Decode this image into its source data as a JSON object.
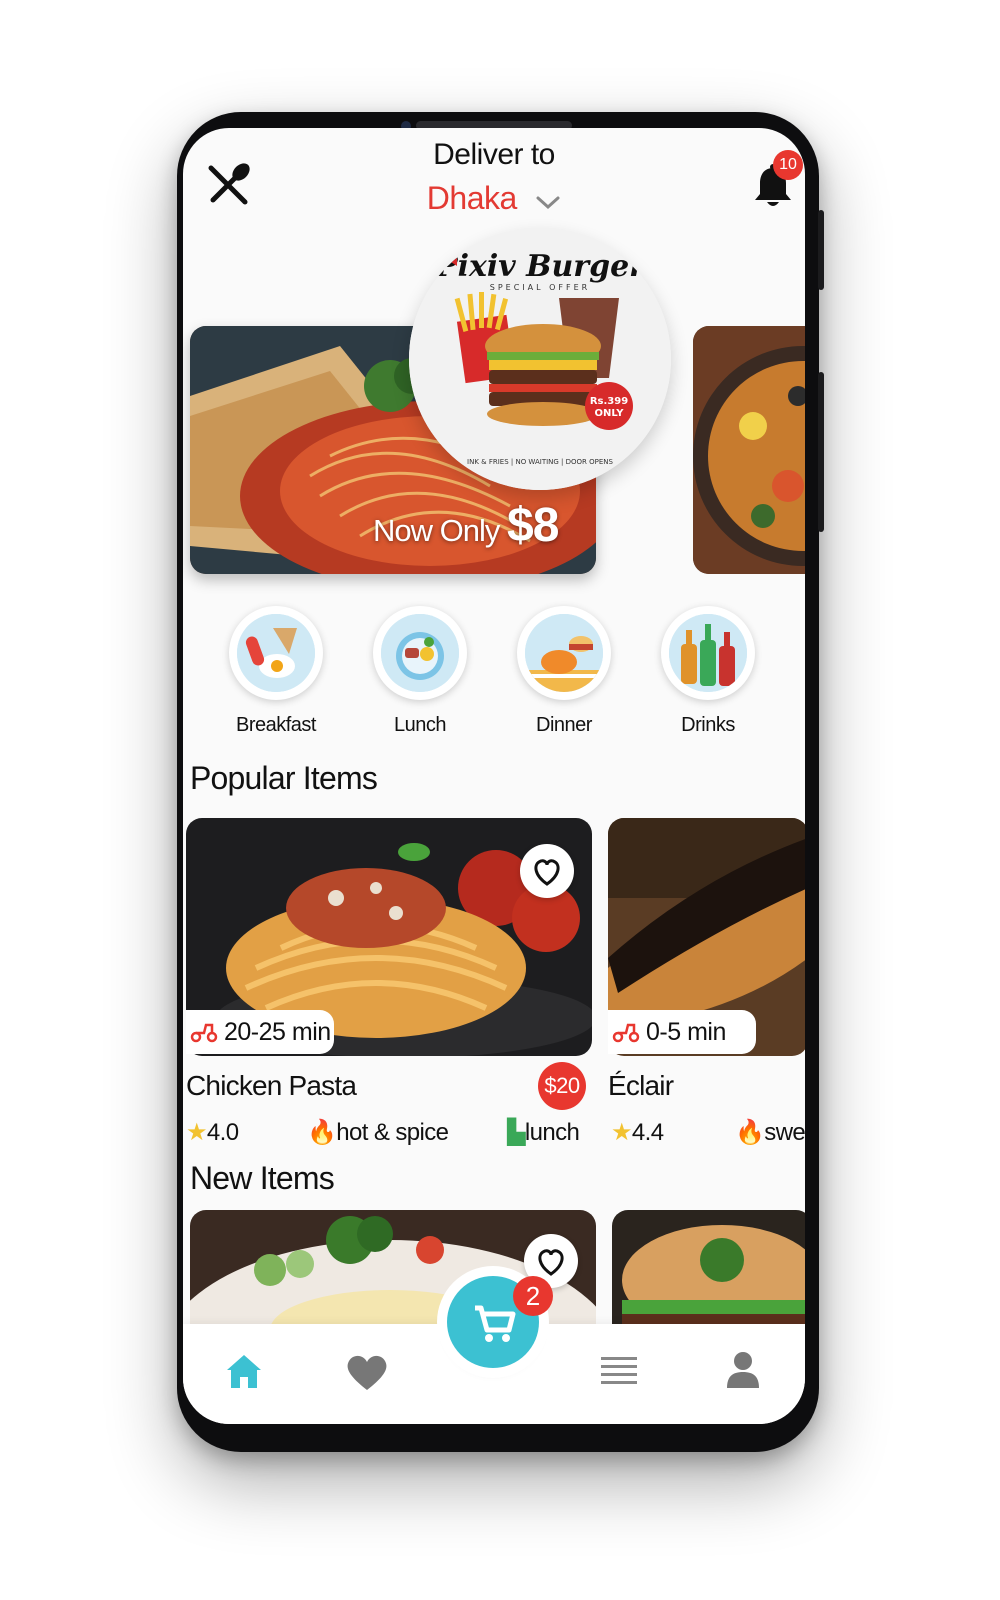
{
  "header": {
    "deliver_label": "Deliver to",
    "city": "Dhaka",
    "notification_count": "10"
  },
  "banner": {
    "price_prefix": "Now Only",
    "price": "$8",
    "promo_brand": "Pixiv Burger",
    "promo_subtitle": "SPECIAL OFFER",
    "promo_price": "Rs.399",
    "promo_only": "ONLY",
    "promo_footer": "INK & FRIES | NO WAITING | DOOR OPENS"
  },
  "categories": [
    {
      "label": "Breakfast",
      "icon": "breakfast-icon"
    },
    {
      "label": "Lunch",
      "icon": "lunch-icon"
    },
    {
      "label": "Dinner",
      "icon": "dinner-icon"
    },
    {
      "label": "Drinks",
      "icon": "drinks-icon"
    }
  ],
  "popular": {
    "title": "Popular Items",
    "items": [
      {
        "name": "Chicken Pasta",
        "time": "20-25 min",
        "price": "$20",
        "rating": "4.0",
        "tag1": "hot & spice",
        "tag2": "lunch"
      },
      {
        "name": "Éclair",
        "time": "0-5 min",
        "rating": "4.4",
        "tag1": "swe"
      }
    ]
  },
  "new_items": {
    "title": "New Items"
  },
  "cart": {
    "count": "2"
  },
  "nav": [
    "home-icon",
    "heart-icon",
    "cart-icon",
    "menu-icon",
    "profile-icon"
  ],
  "colors": {
    "accent": "#3cc1d2",
    "red": "#e8372f"
  }
}
